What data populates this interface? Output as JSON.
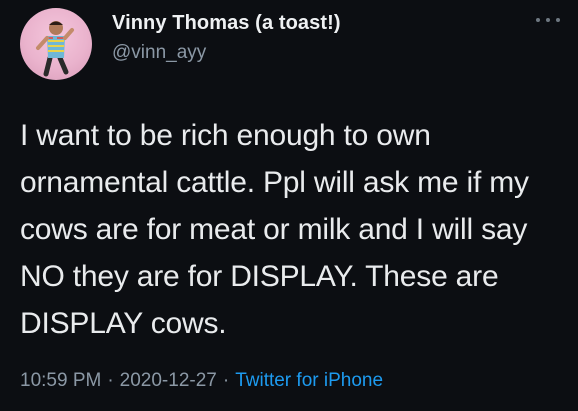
{
  "user": {
    "display_name": "Vinny Thomas (a toast!)",
    "handle": "@vinn_ayy"
  },
  "tweet": {
    "text": "I want to be rich enough to own\nornamental cattle. Ppl will ask me if my\ncows are for meat or milk and I will say\nNO they are for DISPLAY. These are\nDISPLAY cows.",
    "time": "10:59 PM",
    "date": "2020-12-27",
    "source": "Twitter for iPhone",
    "separator": "·"
  },
  "icons": {
    "avatar": "profile-photo",
    "more": "more-options-icon"
  },
  "colors": {
    "background": "#0c0e12",
    "text": "#e9ebed",
    "secondary": "#8b98a5",
    "link": "#1d9bf0"
  }
}
